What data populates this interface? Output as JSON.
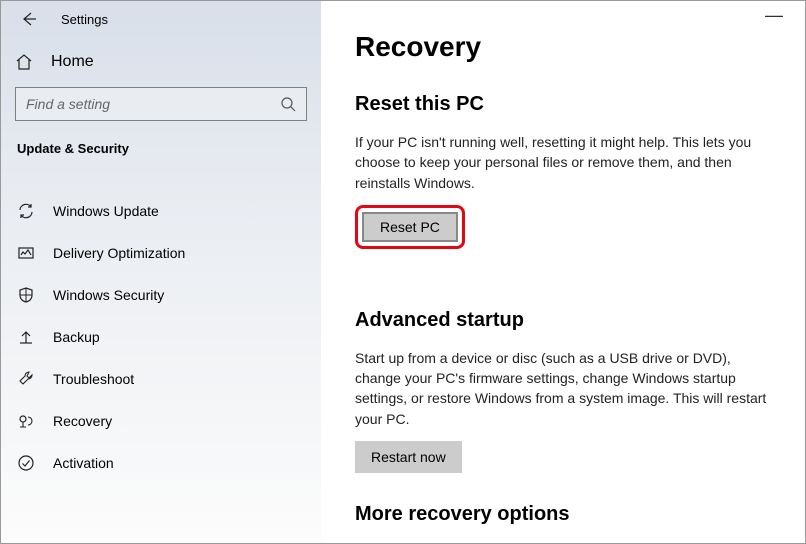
{
  "titlebar": {
    "title": "Settings"
  },
  "sidebar": {
    "home_label": "Home",
    "search_placeholder": "Find a setting",
    "section_label": "Update & Security",
    "items": [
      {
        "label": "Windows Update"
      },
      {
        "label": "Delivery Optimization"
      },
      {
        "label": "Windows Security"
      },
      {
        "label": "Backup"
      },
      {
        "label": "Troubleshoot"
      },
      {
        "label": "Recovery"
      },
      {
        "label": "Activation"
      }
    ]
  },
  "main": {
    "title": "Recovery",
    "reset": {
      "heading": "Reset this PC",
      "desc": "If your PC isn't running well, resetting it might help. This lets you choose to keep your personal files or remove them, and then reinstalls Windows.",
      "button": "Reset PC"
    },
    "advanced": {
      "heading": "Advanced startup",
      "desc": "Start up from a device or disc (such as a USB drive or DVD), change your PC's firmware settings, change Windows startup settings, or restore Windows from a system image. This will restart your PC.",
      "button": "Restart now"
    },
    "more": {
      "heading": "More recovery options"
    }
  }
}
